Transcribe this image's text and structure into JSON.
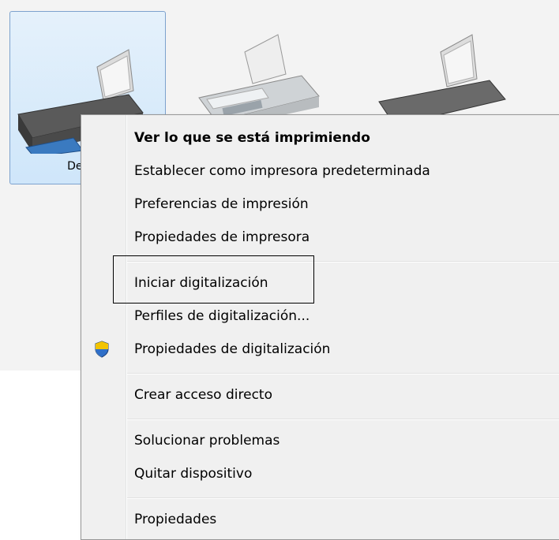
{
  "devices": [
    {
      "label": "Dell MF",
      "selected": true,
      "icon": "printer-icon"
    },
    {
      "label": "",
      "selected": false,
      "icon": "fax-icon"
    },
    {
      "label": "",
      "selected": false,
      "icon": "printer-icon"
    }
  ],
  "context_menu": {
    "items": [
      {
        "label": "Ver lo que se está imprimiendo",
        "bold": true
      },
      {
        "label": "Establecer como impresora predeterminada"
      },
      {
        "label": "Preferencias de impresión"
      },
      {
        "label": "Propiedades de impresora"
      },
      {
        "label": "Iniciar digitalización"
      },
      {
        "label": "Perfiles de digitalización..."
      },
      {
        "label": "Propiedades de digitalización",
        "icon": "uac-shield-icon"
      },
      {
        "label": "Crear acceso directo"
      },
      {
        "label": "Solucionar problemas"
      },
      {
        "label": "Quitar dispositivo"
      },
      {
        "label": "Propiedades"
      }
    ]
  },
  "colors": {
    "selection_border": "#7da2ce",
    "menu_background": "#f0f0f0"
  }
}
